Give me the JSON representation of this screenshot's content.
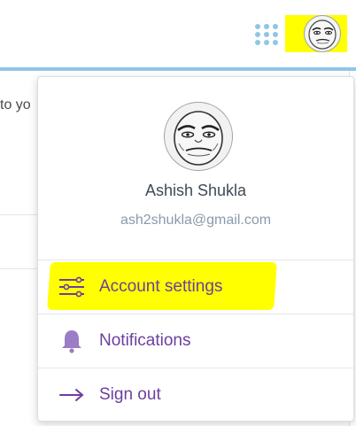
{
  "header": {
    "apps_icon": "grid-apps-icon",
    "avatar_icon": "meme-face-avatar"
  },
  "page": {
    "peek_text": "to yo"
  },
  "dropdown": {
    "user": {
      "name": "Ashish Shukla",
      "email": "ash2shukla@gmail.com",
      "avatar_icon": "meme-face-avatar"
    },
    "items": [
      {
        "label": "Account settings",
        "icon": "sliders-icon",
        "highlighted": true
      },
      {
        "label": "Notifications",
        "icon": "bell-icon",
        "highlighted": false
      },
      {
        "label": "Sign out",
        "icon": "arrow-right-icon",
        "highlighted": false
      }
    ]
  },
  "colors": {
    "accent_purple": "#6b3fa0",
    "header_blue": "#8fc6e8",
    "highlight_yellow": "#ffff00",
    "email_gray": "#8b9aac"
  }
}
